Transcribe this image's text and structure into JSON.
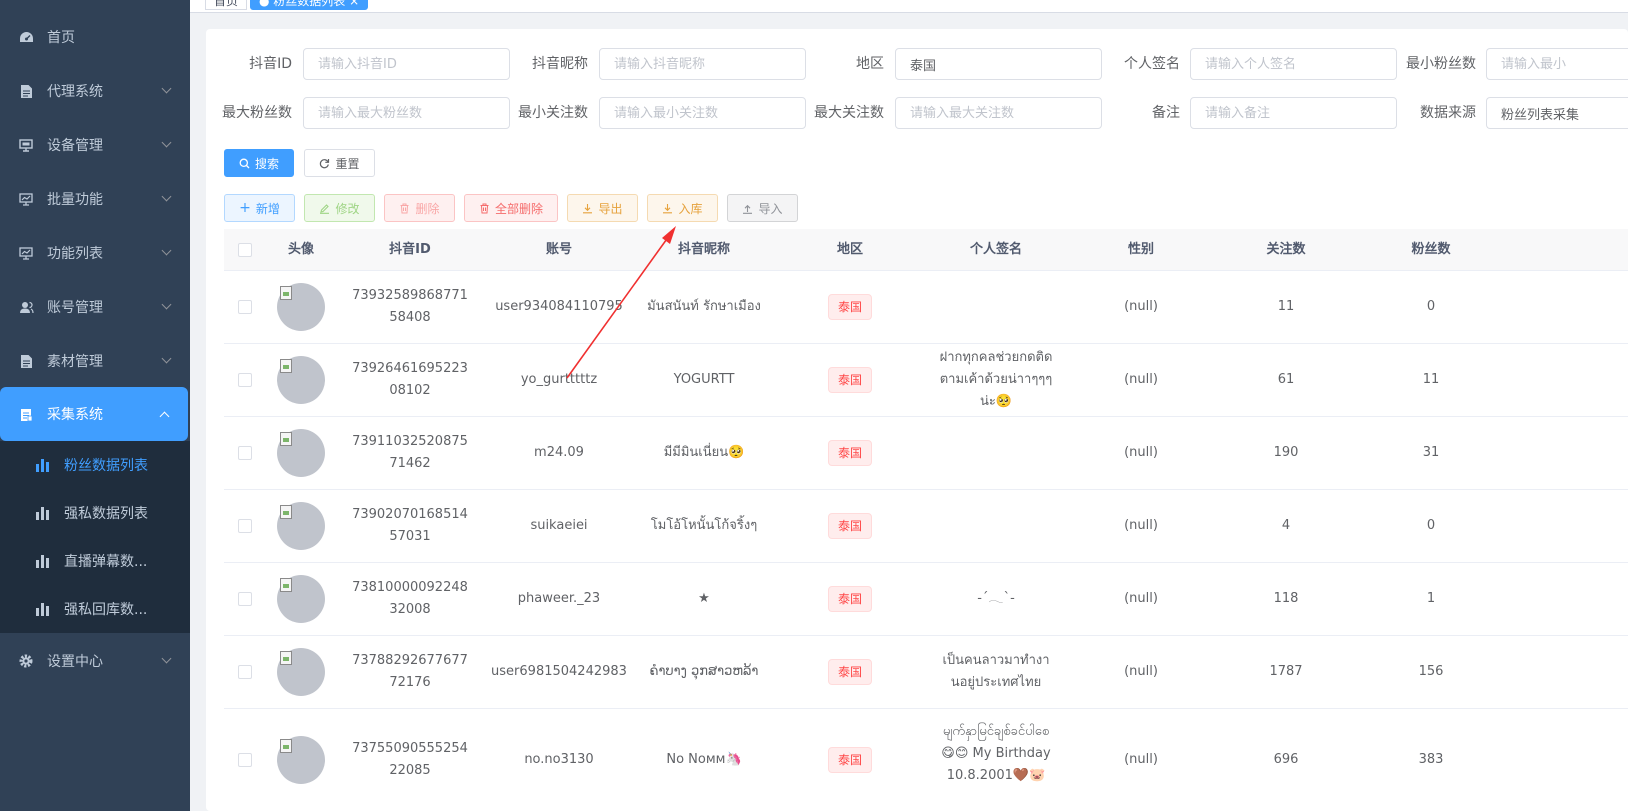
{
  "sidebar": {
    "items": [
      {
        "label": "首页",
        "icon": "dashboard-icon"
      },
      {
        "label": "代理系统",
        "icon": "document-icon"
      },
      {
        "label": "设备管理",
        "icon": "monitor-icon"
      },
      {
        "label": "批量功能",
        "icon": "chart-monitor-icon"
      },
      {
        "label": "功能列表",
        "icon": "chart-monitor-icon"
      },
      {
        "label": "账号管理",
        "icon": "users-icon"
      },
      {
        "label": "素材管理",
        "icon": "document-icon"
      },
      {
        "label": "采集系统",
        "icon": "clipboard-icon"
      },
      {
        "label": "设置中心",
        "icon": "gear-icon"
      }
    ],
    "subitems": [
      {
        "label": "粉丝数据列表",
        "icon": "bar-chart-icon"
      },
      {
        "label": "强私数据列表",
        "icon": "bar-chart-icon"
      },
      {
        "label": "直播弹幕数...",
        "icon": "bar-chart-icon"
      },
      {
        "label": "强私回库数...",
        "icon": "bar-chart-icon"
      }
    ]
  },
  "form": {
    "douyin_id": {
      "label": "抖音ID",
      "placeholder": "请输入抖音ID"
    },
    "nickname": {
      "label": "抖音昵称",
      "placeholder": "请输入抖音昵称"
    },
    "region": {
      "label": "地区",
      "value": "泰国"
    },
    "signature": {
      "label": "个人签名",
      "placeholder": "请输入个人签名"
    },
    "min_fans": {
      "label": "最小粉丝数",
      "placeholder": "请输入最小"
    },
    "max_fans": {
      "label": "最大粉丝数",
      "placeholder": "请输入最大粉丝数"
    },
    "min_follow": {
      "label": "最小关注数",
      "placeholder": "请输入最小关注数"
    },
    "max_follow": {
      "label": "最大关注数",
      "placeholder": "请输入最大关注数"
    },
    "remark": {
      "label": "备注",
      "placeholder": "请输入备注"
    },
    "source": {
      "label": "数据来源",
      "value": "粉丝列表采集"
    }
  },
  "buttons": {
    "search": "搜索",
    "reset": "重置",
    "add": "新增",
    "edit": "修改",
    "delete": "删除",
    "delete_all": "全部删除",
    "export": "导出",
    "store": "入库",
    "import": "导入"
  },
  "table": {
    "headers": [
      "头像",
      "抖音ID",
      "账号",
      "抖音昵称",
      "地区",
      "个人签名",
      "性别",
      "关注数",
      "粉丝数"
    ],
    "rows": [
      {
        "id": "7393258986877158408",
        "account": "user934084110795",
        "nickname": "มันสนันท์ รักษาเมือง",
        "region": "泰国",
        "signature": "",
        "gender": "(null)",
        "follow": "11",
        "fans": "0"
      },
      {
        "id": "7392646169522308102",
        "account": "yo_gurtttttz",
        "nickname": "YOGURTT",
        "region": "泰国",
        "signature": "ฝากทุกคลช่วยกดติดตามเค้าด้วยน่าาๆๆๆน่ะ🥺",
        "gender": "(null)",
        "follow": "61",
        "fans": "11"
      },
      {
        "id": "7391103252087571462",
        "account": "m24.09",
        "nickname": "มีมีมินเนี่ยน🥺",
        "region": "泰国",
        "signature": "",
        "gender": "(null)",
        "follow": "190",
        "fans": "31"
      },
      {
        "id": "7390207016851457031",
        "account": "suikaeiei",
        "nickname": "โมโอ้โหนั้นโก้จริ้งๆ",
        "region": "泰国",
        "signature": "",
        "gender": "(null)",
        "follow": "4",
        "fans": "0"
      },
      {
        "id": "7381000009224832008",
        "account": "phaweer._23",
        "nickname": "★",
        "region": "泰国",
        "signature": "-´𓂃`-",
        "gender": "(null)",
        "follow": "118",
        "fans": "1"
      },
      {
        "id": "7378829267767772176",
        "account": "user6981504242983",
        "nickname": "ຄຳບາງ ວຸກສາວຫລ້າ",
        "region": "泰国",
        "signature": "เป็นคนลาวมาทำงานอยู่ประเทศไทย",
        "gender": "(null)",
        "follow": "1787",
        "fans": "156"
      },
      {
        "id": "7375509055525422085",
        "account": "no.no3130",
        "nickname": "No Nᴏᴍᴍ🦄",
        "region": "泰国",
        "signature": "မျက်နှာမြင်ချစ်ခင်ပါစေ 😋😊 My Birthday 10.8.2001🤎🐷",
        "gender": "(null)",
        "follow": "696",
        "fans": "383"
      }
    ]
  },
  "tags": {
    "first": "首页",
    "active": "● 粉丝数据列表 ×"
  }
}
